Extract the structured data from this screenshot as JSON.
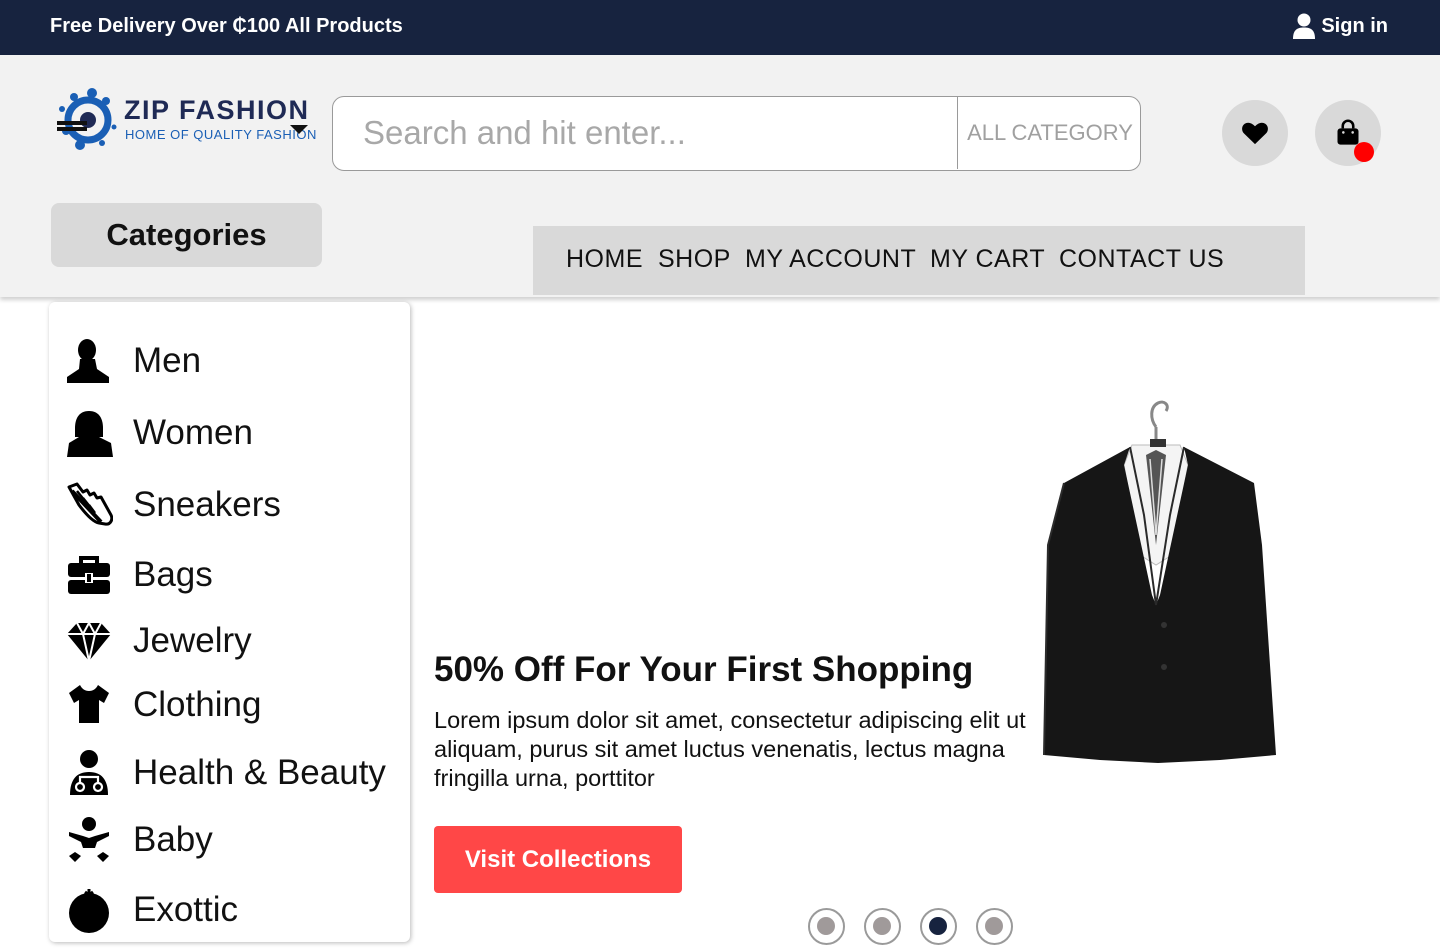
{
  "topbar": {
    "promo": "Free Delivery Over ₵100 All Products",
    "signin_label": "Sign in",
    "signin_icon": "user-icon"
  },
  "header": {
    "logo": {
      "brand": "ZIP FASHION",
      "tagline": "HOME OF QUALITY FASHION"
    },
    "search": {
      "placeholder": "Search and hit enter...",
      "value": "",
      "category_label": "ALL CATEGORY"
    },
    "wishlist_icon": "heart-icon",
    "cart_icon": "shopping-bag-icon",
    "cart_badge_color": "#ff0000"
  },
  "categories_button": "Categories",
  "nav": [
    "HOME",
    "SHOP",
    "MY ACCOUNT",
    "MY CART",
    "CONTACT US"
  ],
  "sidebar": {
    "items": [
      {
        "label": "Men",
        "icon": "man-icon"
      },
      {
        "label": "Women",
        "icon": "woman-icon"
      },
      {
        "label": "Sneakers",
        "icon": "sneaker-icon"
      },
      {
        "label": "Bags",
        "icon": "briefcase-icon"
      },
      {
        "label": "Jewelry",
        "icon": "diamond-icon"
      },
      {
        "label": "Clothing",
        "icon": "tshirt-icon"
      },
      {
        "label": "Health & Beauty",
        "icon": "doctor-icon"
      },
      {
        "label": "Baby",
        "icon": "baby-icon"
      },
      {
        "label": "Exottic",
        "icon": "fruit-icon"
      }
    ]
  },
  "hero": {
    "title": "50% Off For Your First Shopping",
    "text": "Lorem ipsum dolor sit amet, consectetur adipiscing elit ut aliquam, purus sit amet luctus venenatis, lectus magna fringilla urna, porttitor",
    "button": "Visit Collections",
    "image": "suit-jacket-image",
    "slides_count": 4,
    "active_slide": 3
  },
  "colors": {
    "topbar": "#17233f",
    "accent_button": "#ff4747",
    "header_bg": "#f2f2f2",
    "control_gray": "#d9d9d9"
  }
}
